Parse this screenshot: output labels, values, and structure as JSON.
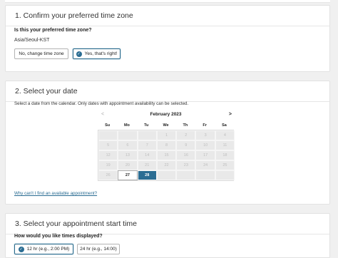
{
  "section1": {
    "title": "1. Confirm your preferred time zone",
    "question": "Is this your preferred time zone?",
    "timezone": "Asia/Seoul-KST",
    "no_button": "No, change time zone",
    "yes_button": "Yes, that's right!"
  },
  "section2": {
    "title": "2. Select your date",
    "description": "Select a date from the calendar. Only dates with appointment availability can be selected.",
    "calendar": {
      "prev": "<",
      "next": ">",
      "month": "February 2023",
      "weekdays": [
        "Su",
        "Mo",
        "Tu",
        "We",
        "Th",
        "Fr",
        "Sa"
      ],
      "days": [
        "",
        "",
        "",
        "1",
        "2",
        "3",
        "4",
        "5",
        "6",
        "7",
        "8",
        "9",
        "10",
        "11",
        "12",
        "13",
        "14",
        "15",
        "16",
        "17",
        "18",
        "19",
        "20",
        "21",
        "22",
        "23",
        "24",
        "25",
        "26",
        "27",
        "28",
        "",
        "",
        "",
        ""
      ],
      "available_days": [
        "27"
      ],
      "selected_day": "28"
    },
    "help_link": "Why can't I find an available appointment?"
  },
  "section3": {
    "title": "3. Select your appointment start time",
    "question": "How would you like times displayed?",
    "format_12": "12 hr (e.g., 2:00 PM)",
    "format_24": "24 hr (e.g., 14:00)"
  },
  "colors": {
    "accent": "#2b6d93",
    "background": "#f0f0f0"
  }
}
